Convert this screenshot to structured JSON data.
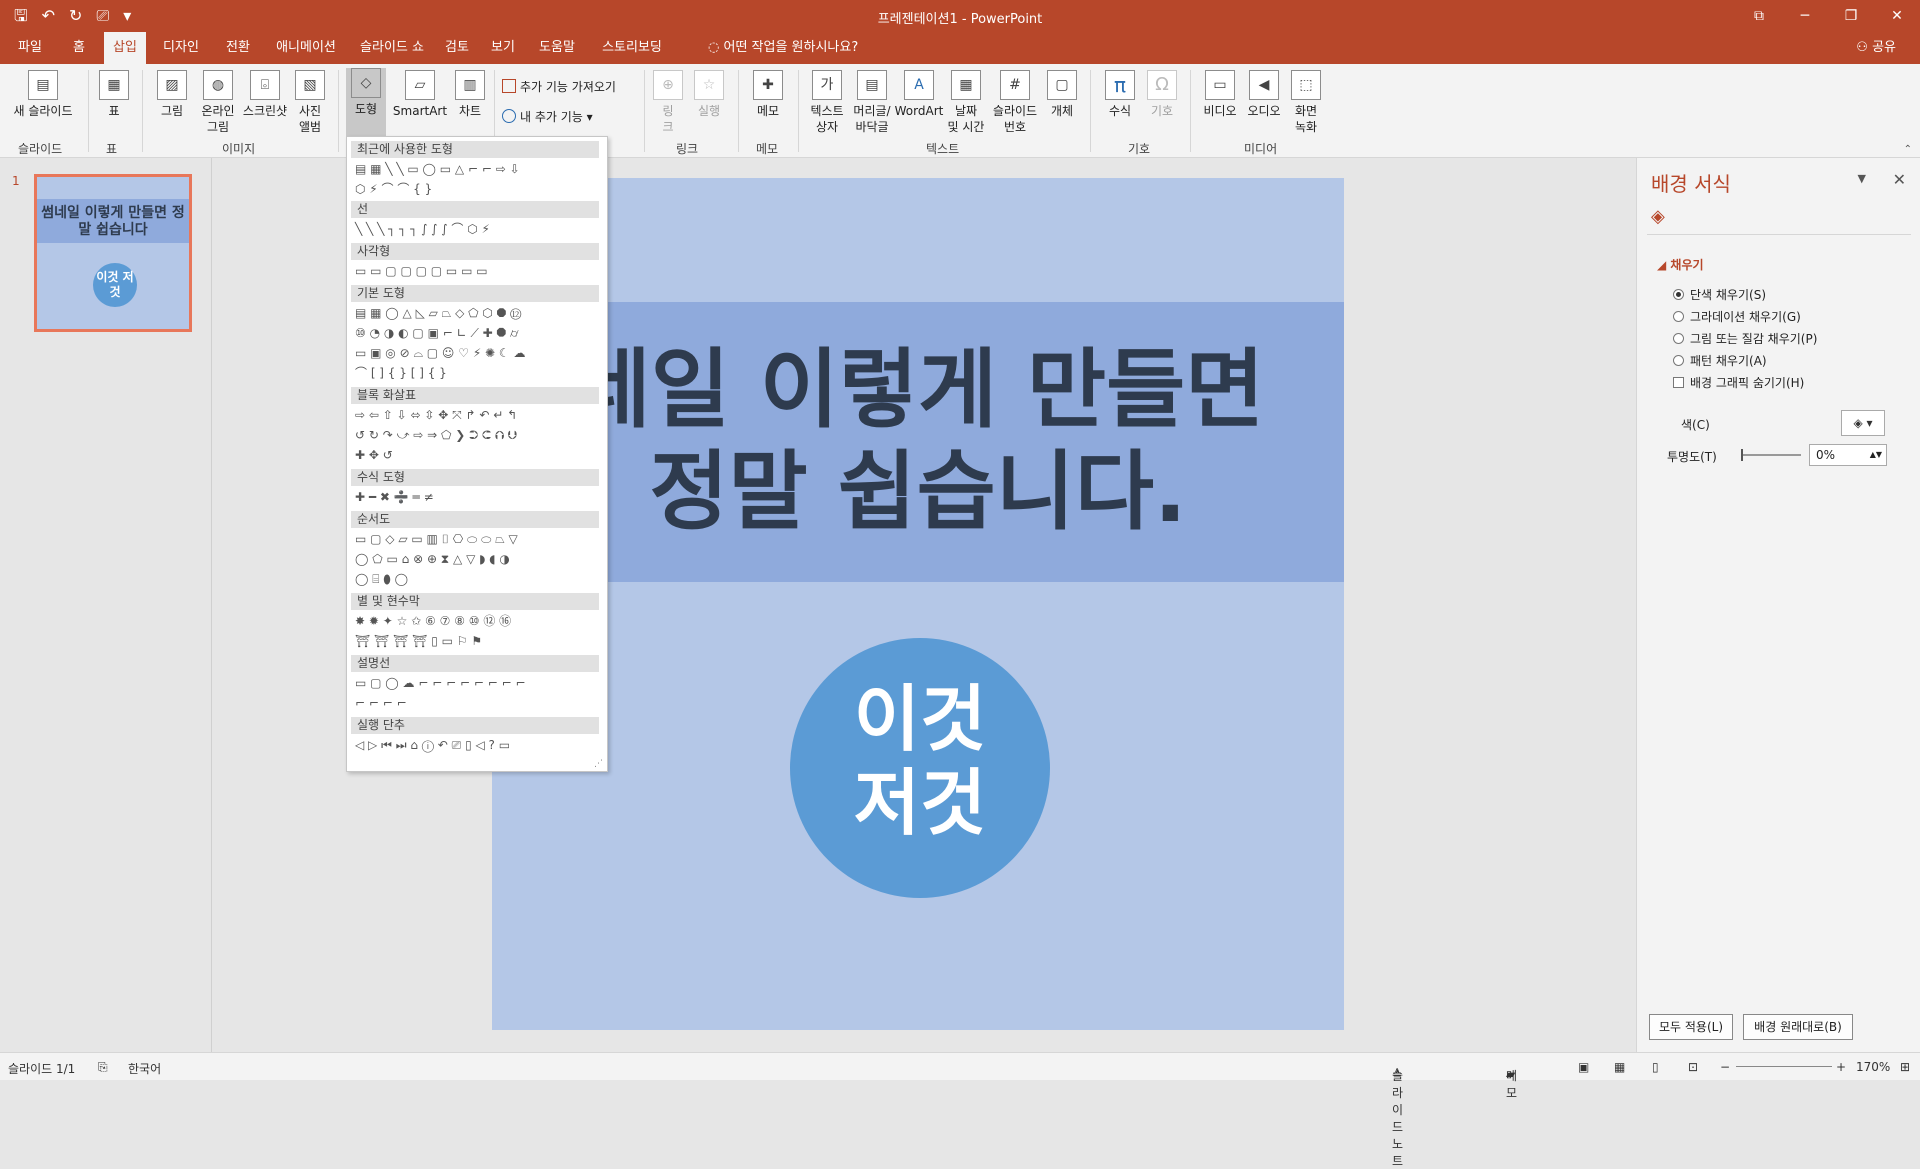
{
  "window": {
    "title": "프레젠테이션1  -  PowerPoint",
    "controls": [
      "⧉",
      "─",
      "❐",
      "✕"
    ]
  },
  "quick_access": [
    "🖫",
    "↶",
    "↻",
    "⎚",
    "▾"
  ],
  "tabs": [
    "파일",
    "홈",
    "삽입",
    "디자인",
    "전환",
    "애니메이션",
    "슬라이드 쇼",
    "검토",
    "보기",
    "도움말",
    "스토리보딩"
  ],
  "active_tab": "삽입",
  "tell_me": "어떤 작업을 원하시나요?",
  "share": "공유",
  "ribbon": {
    "new_slide": "새 슬라이드",
    "table": "표",
    "picture": "그림",
    "online_picture_1": "온라인",
    "online_picture_2": "그림",
    "screenshot": "스크린샷",
    "photo_album_1": "사진",
    "photo_album_2": "앨범",
    "shapes": "도형",
    "smartart": "SmartArt",
    "chart": "차트",
    "get_addins": "추가 기능 가져오기",
    "my_addins": "내 추가 기능",
    "link_1": "링",
    "link_2": "크",
    "action": "실행",
    "comment": "메모",
    "textbox_1": "텍스트",
    "textbox_2": "상자",
    "header_footer_1": "머리글/",
    "header_footer_2": "바닥글",
    "wordart": "WordArt",
    "datetime_1": "날짜",
    "datetime_2": "및 시간",
    "slide_number_1": "슬라이드",
    "slide_number_2": "번호",
    "object": "개체",
    "equation": "수식",
    "symbol": "기호",
    "video": "비디오",
    "audio": "오디오",
    "screen_rec_1": "화면",
    "screen_rec_2": "녹화",
    "groups": {
      "slides": "슬라이드",
      "tables": "표",
      "images": "이미지",
      "links": "링크",
      "comments": "메모",
      "text": "텍스트",
      "symbols": "기호",
      "media": "미디어"
    }
  },
  "shapes_menu": {
    "sections": [
      "최근에 사용한 도형",
      "선",
      "사각형",
      "기본 도형",
      "블록 화살표",
      "수식 도형",
      "순서도",
      "별 및 현수막",
      "설명선",
      "실행 단추"
    ],
    "recent_rows": [
      "▤ ▦ ╲ ╲ ▭ ◯ ▭ △ ⌐ ⌐ ⇨ ⇩",
      "⬡ ⚡ ⌒ ⌒ { }"
    ],
    "lines_row": "╲ ╲ ╲ ┐ ┐ ┐ ∫ ∫ ∫ ⌒ ⬡ ⚡",
    "rect_row": "▭ ▭ ▢ ▢ ▢ ▢ ▭ ▭ ▭",
    "basic_rows": [
      "▤ ▦ ◯ △ ◺ ▱ ⏢ ◇ ⬠ ⬡ ⯃ ⑫",
      "⑩ ◔ ◑ ◐ ▢ ▣ ⌐ ∟ ⟋ ✚ ⯃ ⌭",
      "▭ ▣ ◎ ⊘ ⌓ ▢ ☺ ♡ ⚡ ✺ ☾ ☁",
      "⌒ [ ] { } [ ] { }"
    ],
    "arrow_rows": [
      "⇨ ⇦ ⇧ ⇩ ⬄ ⇳ ✥ ⤧ ↱ ↶ ↵ ↰",
      "↺ ↻ ↷ ⤻ ⇨ ⇒ ⬠ ❯ ⮊ ⮈ ⮉ ⮋",
      "✚ ✥ ↺"
    ],
    "equation_row": "✚ ━ ✖ ➗ ═ ≠",
    "flow_rows": [
      "▭ ▢ ◇ ▱ ▭ ▥ ⌷ ⎔ ⬭ ⬭ ⏢ ▽",
      "◯ ⬠ ▭ ⌂ ⊗ ⊕ ⧗ △ ▽ ◗ ◖ ◑",
      "◯ ⌸ ⬮ ◯"
    ],
    "star_rows": [
      "✸ ✹ ✦ ☆ ✩ ⑥ ⑦ ⑧ ⑩ ⑫ ⑯",
      "⛩ ⛩ ⛩ ⛩ ▯ ▭ ⚐ ⚑"
    ],
    "callout_rows": [
      "▭ ▢ ◯ ☁ ⌐ ⌐ ⌐ ⌐ ⌐ ⌐ ⌐ ⌐",
      "⌐ ⌐ ⌐ ⌐"
    ],
    "action_row": "◁ ▷ ⏮ ⏭ ⌂ ⓘ ↶ ⎚ ▯ ◁ ? ▭"
  },
  "thumbnail": {
    "number": "1",
    "title": "썸네일 이렇게 만들면 정말 쉽습니다",
    "circle": "이것 저것"
  },
  "slide": {
    "line1": "네일 이렇게 만들면",
    "line2": "정말 쉽습니다.",
    "circle1": "이것",
    "circle2": "저것"
  },
  "format_pane": {
    "title": "배경 서식",
    "fill_header": "채우기",
    "options": [
      "단색 채우기(S)",
      "그라데이션 채우기(G)",
      "그림 또는 질감 채우기(P)",
      "패턴 채우기(A)"
    ],
    "selected_option": 0,
    "hide_graphics": "배경 그래픽 숨기기(H)",
    "color_label": "색(C)",
    "transparency_label": "투명도(T)",
    "transparency_value": "0%",
    "apply_all": "모두 적용(L)",
    "reset_bg": "배경 원래대로(B)"
  },
  "status": {
    "slide_count": "슬라이드 1/1",
    "language": "한국어",
    "notes": "슬라이드 노트",
    "comments": "메모",
    "zoom": "170%"
  },
  "colors": {
    "accent": "#b7472a",
    "slide_bg": "#b4c7e7",
    "band": "#8faadc",
    "circle": "#5b9bd5",
    "title_text": "#2e3b4e"
  }
}
